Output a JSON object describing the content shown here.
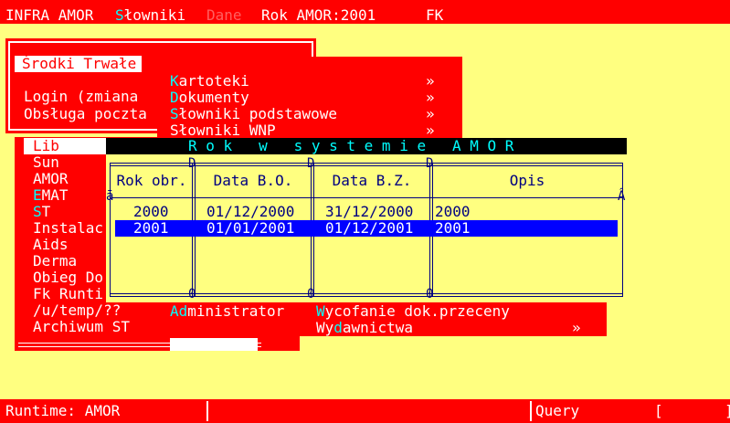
{
  "menubar": {
    "items": [
      {
        "label": "INFRA AMOR",
        "hotkey": "",
        "rest": "INFRA AMOR"
      },
      {
        "label": "Słowniki",
        "hotkey": "S",
        "rest": "łowniki"
      },
      {
        "label": "Dane",
        "hotkey": "",
        "rest": "Dane"
      },
      {
        "label": "Rok AMOR:2001",
        "hotkey": "",
        "rest": "Rok AMOR:2001"
      },
      {
        "label": "FK",
        "hotkey": "",
        "rest": "FK"
      }
    ]
  },
  "left_menu": {
    "selected": "Środki Trwałe",
    "login": "Login (zmiana",
    "mail": "Obsługa poczta"
  },
  "submenu1": {
    "items": [
      {
        "hotkey": "K",
        "rest": "artoteki",
        "arrow": "»"
      },
      {
        "hotkey": "D",
        "rest": "okumenty",
        "arrow": "»"
      },
      {
        "hotkey": "S",
        "rest": "łowniki podstawowe",
        "arrow": "»"
      },
      {
        "hotkey": "S",
        "rest": "łowniki WNP",
        "arrow": "»"
      }
    ],
    "admin_hotkey": "Ad",
    "admin_rest": "ministrator"
  },
  "left_list": {
    "selected": "Lib",
    "items": [
      "Sun",
      "AMOR",
      "EMAT",
      "ST",
      "Instalac",
      "Aids",
      "Derma",
      "Obieg Do",
      "Fk Runti",
      "/u/temp/??",
      "Archiwum ST"
    ],
    "hotkeys": {
      "EMAT": "E",
      "ST": "S"
    }
  },
  "submenu2": {
    "item1_hotkey": "W",
    "item1_rest": "ycofanie dok.przeceny",
    "item2_pre": "Wy",
    "item2_hotkey": "d",
    "item2_rest": "awnictwa",
    "arrow": "»"
  },
  "dialog": {
    "title": "R o k   w   s y s t e m i e   A M O R",
    "columns": [
      "Rok obr.",
      "Data B.O.",
      "Data B.Z.",
      "Opis"
    ],
    "rows": [
      {
        "rok": "2000",
        "bo": "01/12/2000",
        "bz": "31/12/2000",
        "opis": "2000",
        "selected": false
      },
      {
        "rok": "2001",
        "bo": "01/01/2001",
        "bz": "01/12/2001",
        "opis": "2001",
        "selected": true
      }
    ]
  },
  "statusbar": {
    "runtime": "Runtime: AMOR",
    "mode": "Query",
    "indicator": "[       ]"
  },
  "colors": {
    "background": "#ffff80",
    "menu": "#ff0000",
    "hotkey": "#00ffff",
    "selection": "#0000ff",
    "frame": "#000080"
  }
}
